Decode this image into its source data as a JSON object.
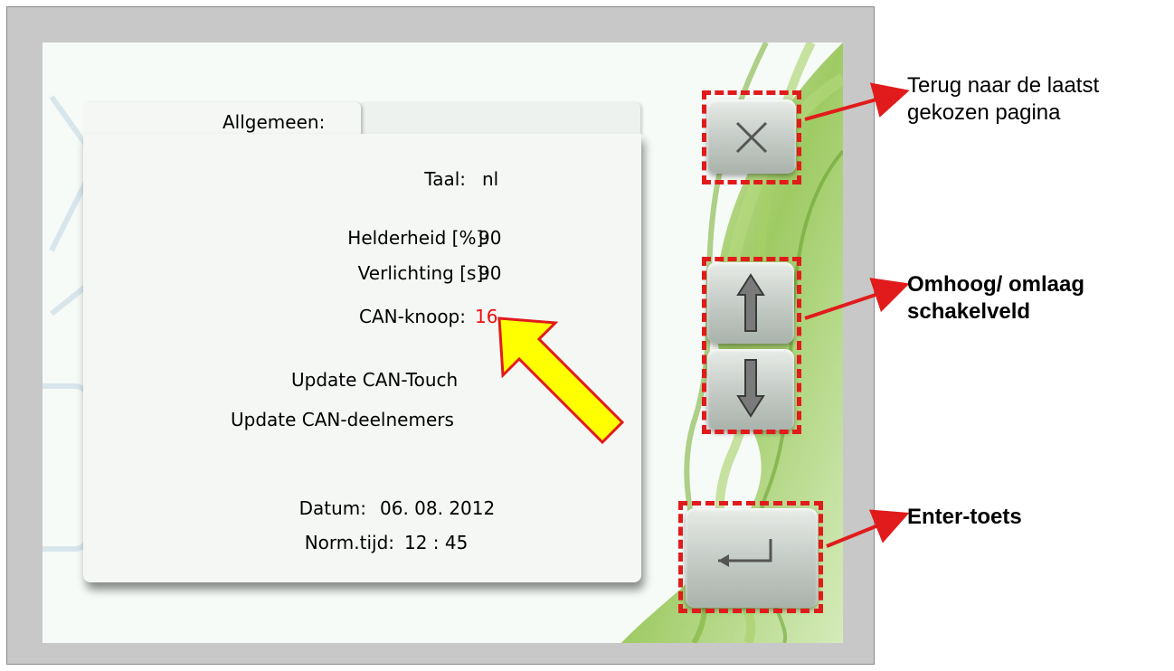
{
  "panel": {
    "tab_label": "Allgemeen:",
    "rows": {
      "taal": {
        "label": "Taal:",
        "value": "nl"
      },
      "helderheid": {
        "label": "Helderheid [%]:",
        "value": "90"
      },
      "verlichting": {
        "label": "Verlichting [s]:",
        "value": "90"
      },
      "can_knoop": {
        "label": "CAN-knoop:",
        "value": "16"
      }
    },
    "actions": {
      "update_touch": "Update CAN-Touch",
      "update_nodes": "Update CAN-deelnemers"
    },
    "date": {
      "label": "Datum:",
      "value": "06. 08. 2012"
    },
    "time": {
      "label": "Norm.tijd:",
      "value": "12 : 45"
    }
  },
  "buttons": {
    "close": {
      "icon": "close-icon"
    },
    "up": {
      "icon": "arrow-up-icon"
    },
    "down": {
      "icon": "arrow-down-icon"
    },
    "enter": {
      "icon": "enter-icon"
    }
  },
  "annotations": {
    "close_line1": "Terug naar de laatst",
    "close_line2": "gekozen pagina",
    "updown_line1": "Omhoog/ omlaag",
    "updown_line2": "schakelveld",
    "enter": "Enter-toets"
  },
  "colors": {
    "highlight": "#e11b1b",
    "pointer_fill": "#ffff00",
    "frame": "#c8c8c8"
  }
}
